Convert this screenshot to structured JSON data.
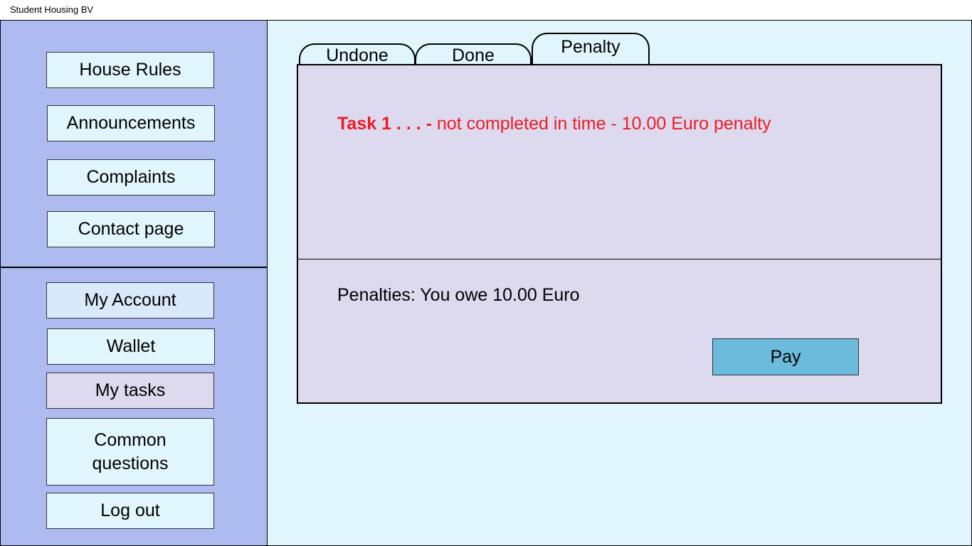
{
  "window": {
    "title": "Student Housing BV"
  },
  "sidebar": {
    "top_items": [
      {
        "label": "House Rules"
      },
      {
        "label": "Announcements"
      },
      {
        "label": "Complaints"
      },
      {
        "label": "Contact page"
      }
    ],
    "bottom_items": [
      {
        "label": "My Account"
      },
      {
        "label": "Wallet"
      },
      {
        "label": "My tasks"
      },
      {
        "label": "Common questions"
      },
      {
        "label": "Log out"
      }
    ]
  },
  "tabs": [
    {
      "label": "Undone"
    },
    {
      "label": "Done"
    },
    {
      "label": "Penalty",
      "active": true
    }
  ],
  "penalty": {
    "task": "Task 1 . . . -",
    "detail": " not completed in time - 10.00 Euro penalty"
  },
  "summary": {
    "owe_text": "Penalties: You owe 10.00 Euro",
    "pay_label": "Pay"
  },
  "colors": {
    "sidebar_bg": "#aebbf0",
    "main_bg": "#e1f6fc",
    "panel_bg": "#ddd9ef",
    "penalty_text": "#ed1c24",
    "pay_button": "#6cbbdc",
    "my_account_bg": "#dae8fb",
    "my_tasks_bg": "#ddd9ef"
  }
}
